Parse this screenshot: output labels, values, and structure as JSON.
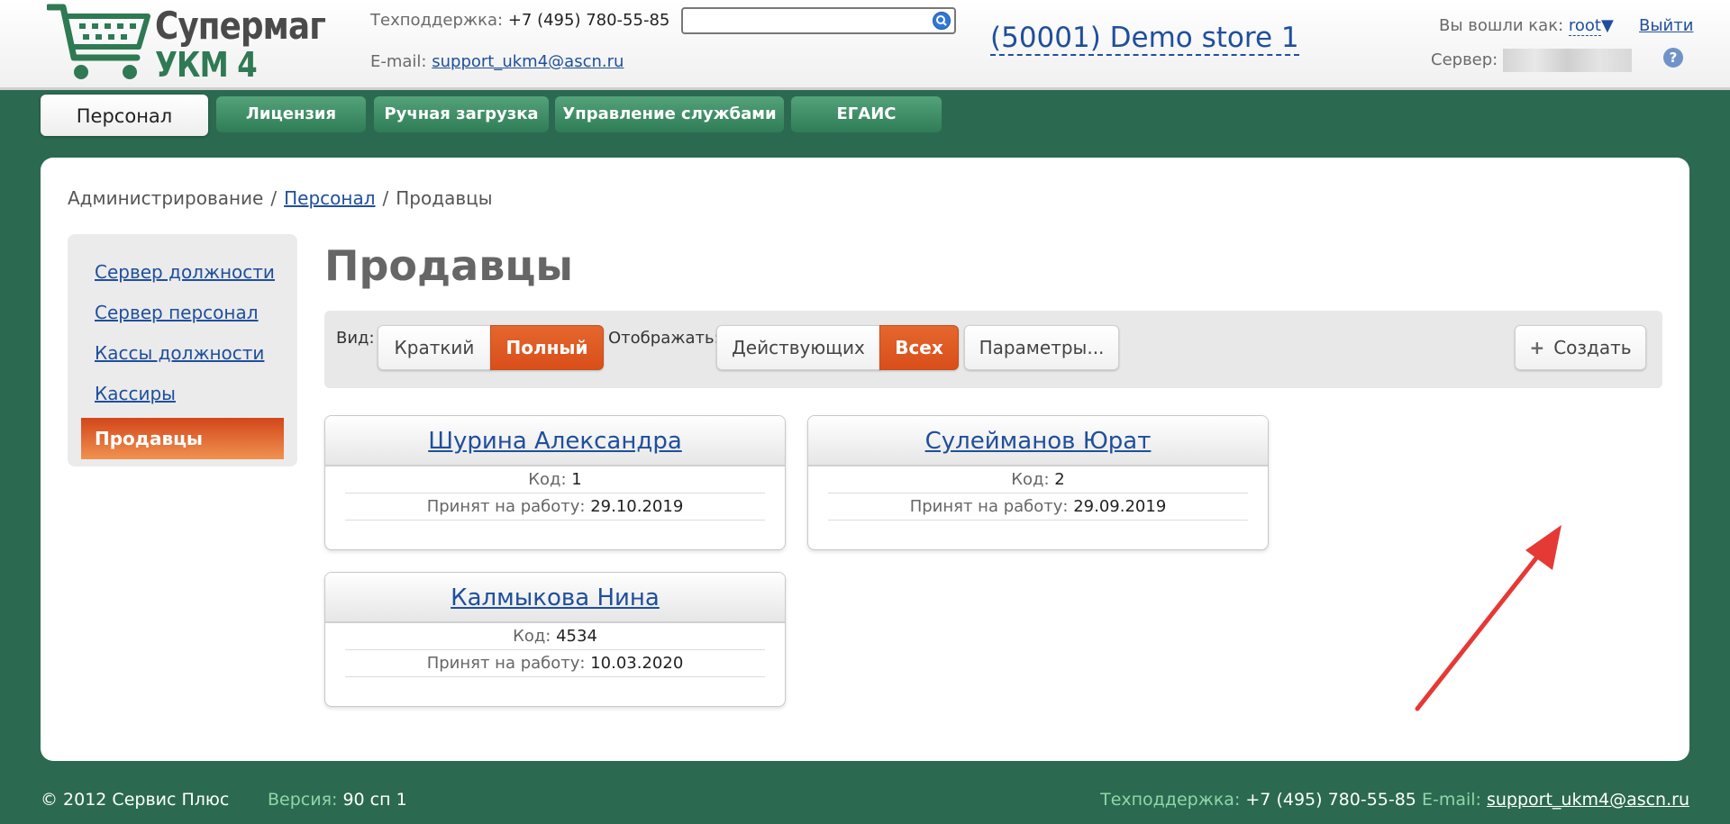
{
  "header": {
    "logo_line1": "Супермаг",
    "logo_line2": "УКМ 4",
    "support_label": "Техподдержка:",
    "support_phone": "+7 (495) 780-55-85",
    "email_label": "E-mail:",
    "email": "support_ukm4@ascn.ru",
    "search_placeholder": "",
    "store": "(50001) Demo store 1",
    "logged_in_label": "Вы вошли как:",
    "user": "root",
    "logout": "Выйти",
    "server_label": "Сервер:",
    "help": "?"
  },
  "tabs": [
    {
      "label": "Персонал",
      "active": true
    },
    {
      "label": "Лицензия"
    },
    {
      "label": "Ручная загрузка"
    },
    {
      "label": "Управление службами"
    },
    {
      "label": "ЕГАИС"
    }
  ],
  "breadcrumb": {
    "root": "Администрирование",
    "link": "Персонал",
    "current": "Продавцы",
    "sep": "/"
  },
  "sidebar": {
    "items": [
      {
        "label": "Сервер должности"
      },
      {
        "label": "Сервер персонал"
      },
      {
        "label": "Кассы должности"
      },
      {
        "label": "Кассиры"
      },
      {
        "label": "Продавцы",
        "active": true
      }
    ]
  },
  "page": {
    "title": "Продавцы"
  },
  "toolbar": {
    "view_label": "Вид:",
    "view_short": "Краткий",
    "view_full": "Полный",
    "show_label": "Отображать:",
    "show_active": "Действующих",
    "show_all": "Всех",
    "params": "Параметры...",
    "create": "Создать",
    "create_icon": "+"
  },
  "sellers": [
    {
      "name": "Шурина Александра",
      "code_label": "Код:",
      "code": "1",
      "hired_label": "Принят на работу:",
      "hired": "29.10.2019"
    },
    {
      "name": "Сулейманов Юрат",
      "code_label": "Код:",
      "code": "2",
      "hired_label": "Принят на работу:",
      "hired": "29.09.2019"
    },
    {
      "name": "Калмыкова Нина",
      "code_label": "Код:",
      "code": "4534",
      "hired_label": "Принят на работу:",
      "hired": "10.03.2020"
    }
  ],
  "footer": {
    "copyright": "© 2012 Сервис Плюс",
    "version_label": "Версия:",
    "version": "90 сп 1",
    "support_label": "Техподдержка:",
    "support_phone": "+7 (495) 780-55-85",
    "email_label": "E-mail:",
    "email": "support_ukm4@ascn.ru"
  },
  "colors": {
    "brand_green": "#2b6a50",
    "accent_orange": "#e05a22",
    "link_blue": "#1f4f9c",
    "annotation_arrow": "#e53935"
  }
}
